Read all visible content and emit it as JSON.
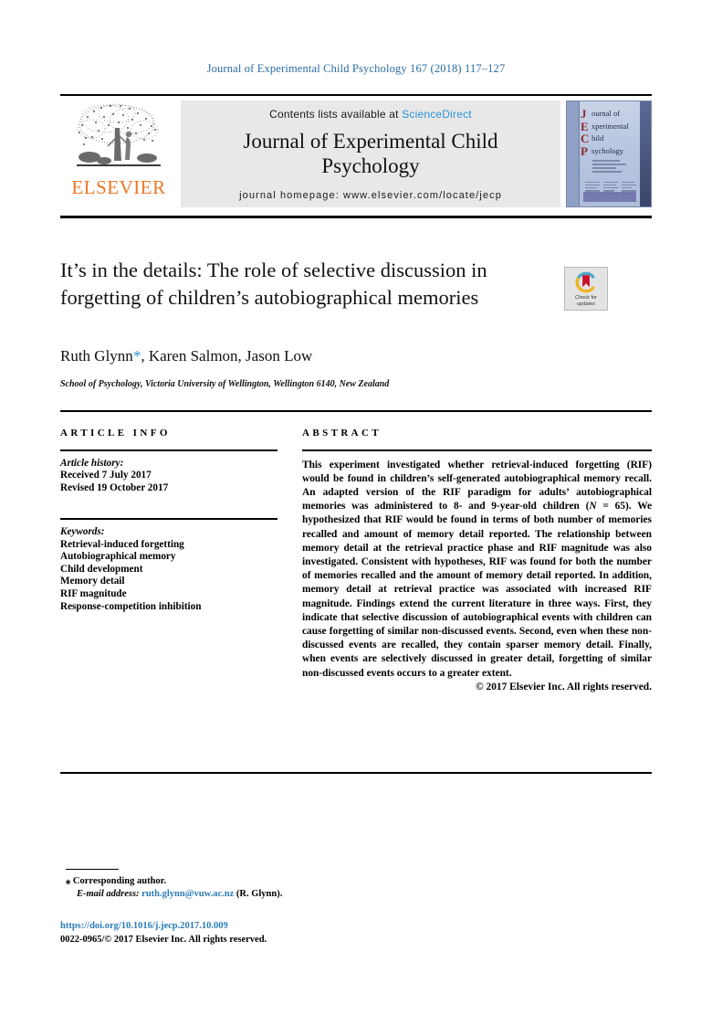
{
  "running_head": "Journal of Experimental Child Psychology 167 (2018) 117–127",
  "masthead": {
    "publisher_name": "ELSEVIER",
    "contents_prefix": "Contents lists available at ",
    "contents_link": "ScienceDirect",
    "journal_title": "Journal of Experimental Child Psychology",
    "homepage": "journal homepage: www.elsevier.com/locate/jecp",
    "cover": {
      "initials": [
        "J",
        "E",
        "C",
        "P"
      ],
      "words": [
        "ournal of",
        "xperimental",
        "hild",
        "sychology"
      ]
    }
  },
  "article": {
    "title": "It’s in the details: The role of selective discussion in forgetting of children’s autobiographical memories",
    "authors_prefix": "Ruth Glynn",
    "authors_star": "*",
    "authors_rest": ", Karen Salmon, Jason Low",
    "affiliation": "School of Psychology, Victoria University of Wellington, Wellington 6140, New Zealand",
    "crossmark_line1": "Check for",
    "crossmark_line2": "updates"
  },
  "article_info": {
    "heading": "ARTICLE INFO",
    "history_label": "Article history:",
    "history": [
      "Received 7 July 2017",
      "Revised 19 October 2017"
    ],
    "keywords_label": "Keywords:",
    "keywords": [
      "Retrieval-induced forgetting",
      "Autobiographical memory",
      "Child development",
      "Memory detail",
      "RIF magnitude",
      "Response-competition inhibition"
    ]
  },
  "abstract": {
    "heading": "ABSTRACT",
    "body_part1": "This experiment investigated whether retrieval-induced forgetting (RIF) would be found in children’s self-generated autobiographical memory recall. An adapted version of the RIF paradigm for adults’ autobiographical memories was administered to 8- and 9-year-old children (",
    "body_n_italic": "N",
    "body_n_value": " = 65). ",
    "body_part2": "We hypothesized that RIF would be found in terms of both number of memories recalled and amount of memory detail reported. The relationship between memory detail at the retrieval practice phase and RIF magnitude was also investigated. Consistent with hypotheses, RIF was found for both the number of memories recalled and the amount of memory detail reported. In addition, memory detail at retrieval practice was associated with increased RIF magnitude. Findings extend the current literature in three ways. First, they indicate that selective discussion of autobiographical events with children can cause forgetting of similar non-discussed events. Second, even when these non-discussed events are recalled, they contain sparser memory detail. Finally, when events are selectively discussed in greater detail, forgetting of similar non-discussed events occurs to a greater extent.",
    "copyright": "© 2017 Elsevier Inc. All rights reserved."
  },
  "footnotes": {
    "corresponding_marker": "⁎",
    "corresponding_text": "Corresponding author.",
    "email_label": "E-mail address:",
    "email": "ruth.glynn@vuw.ac.nz",
    "email_suffix": "(R. Glynn).",
    "doi": "https://doi.org/10.1016/j.jecp.2017.10.009",
    "issn_line": "0022-0965/© 2017 Elsevier Inc. All rights reserved."
  },
  "colors": {
    "link_blue": "#2a93d5",
    "running_head_blue": "#2b6ca3",
    "elsevier_orange": "#ee7623",
    "masthead_grey": "#e8e8e8"
  }
}
